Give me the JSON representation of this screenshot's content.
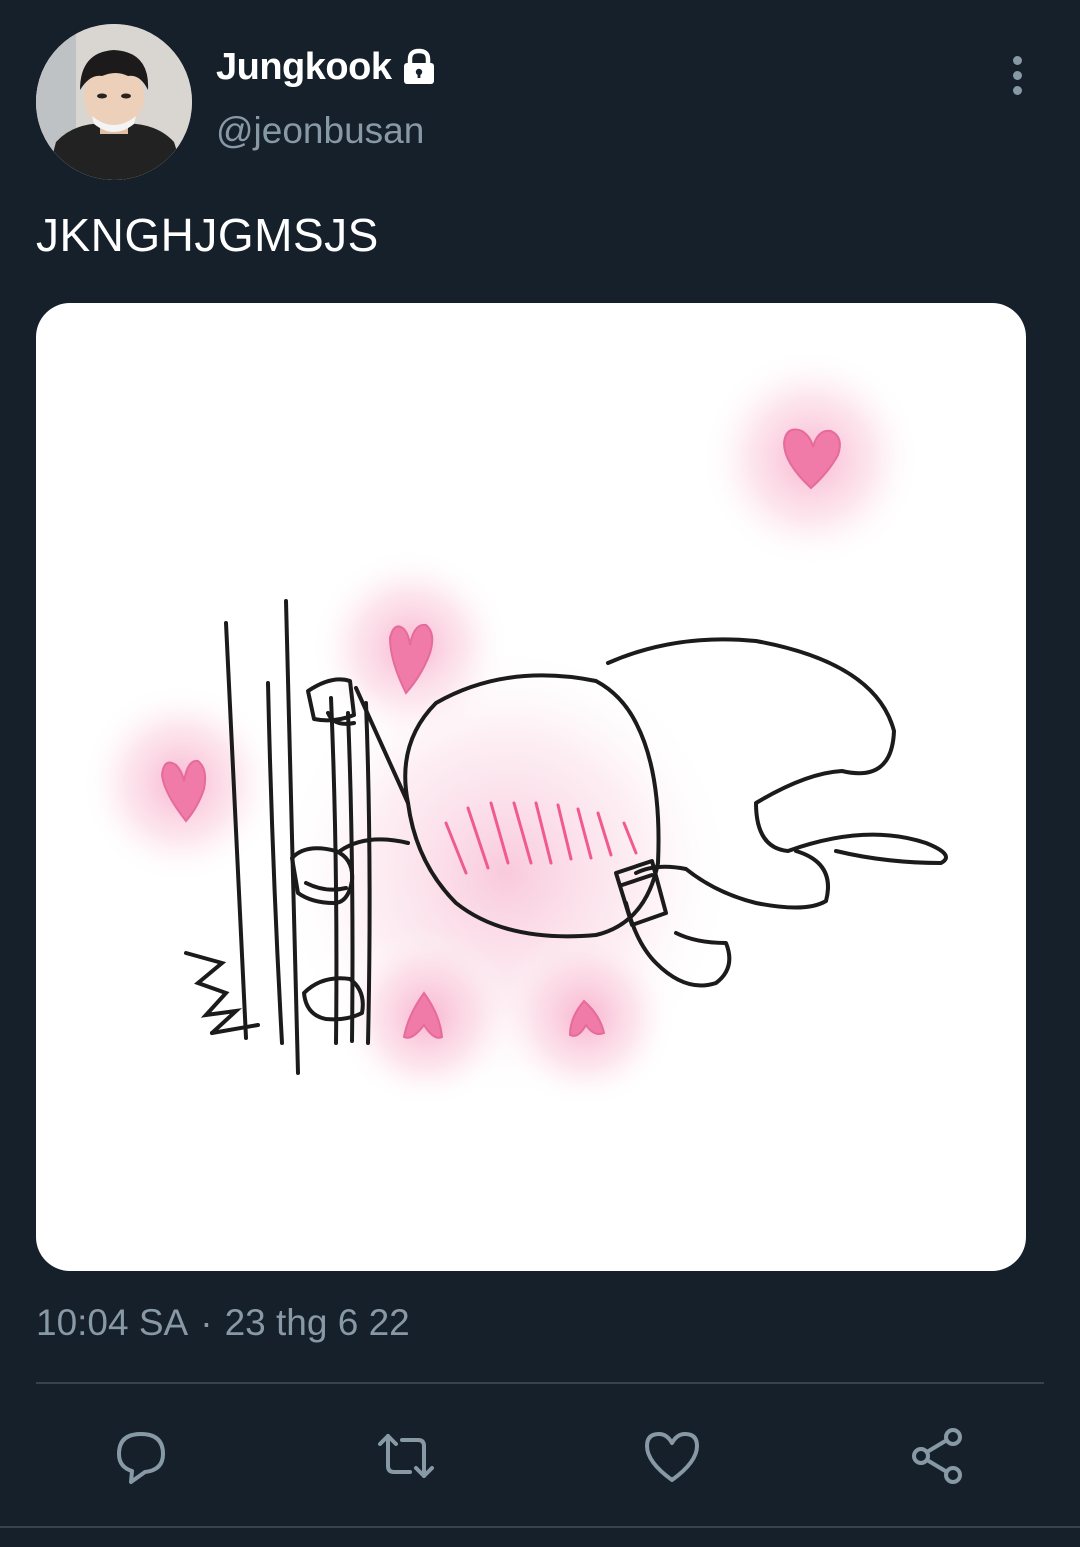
{
  "author": {
    "display_name": "Jungkook",
    "handle": "@jeonbusan",
    "protected": true
  },
  "tweet": {
    "text": "JKNGHJGMSJS",
    "time": "10:04 SA",
    "separator": "·",
    "date": "23 thg 6 22"
  },
  "icons": {
    "reply": "reply-icon",
    "retweet": "retweet-icon",
    "like": "heart-icon",
    "share": "share-icon",
    "more": "more-vertical-icon",
    "lock": "lock-icon"
  },
  "colors": {
    "background": "#15202b",
    "secondary_text": "#8899a6",
    "divider": "#38444d",
    "heart_pink": "#f07aa8"
  }
}
